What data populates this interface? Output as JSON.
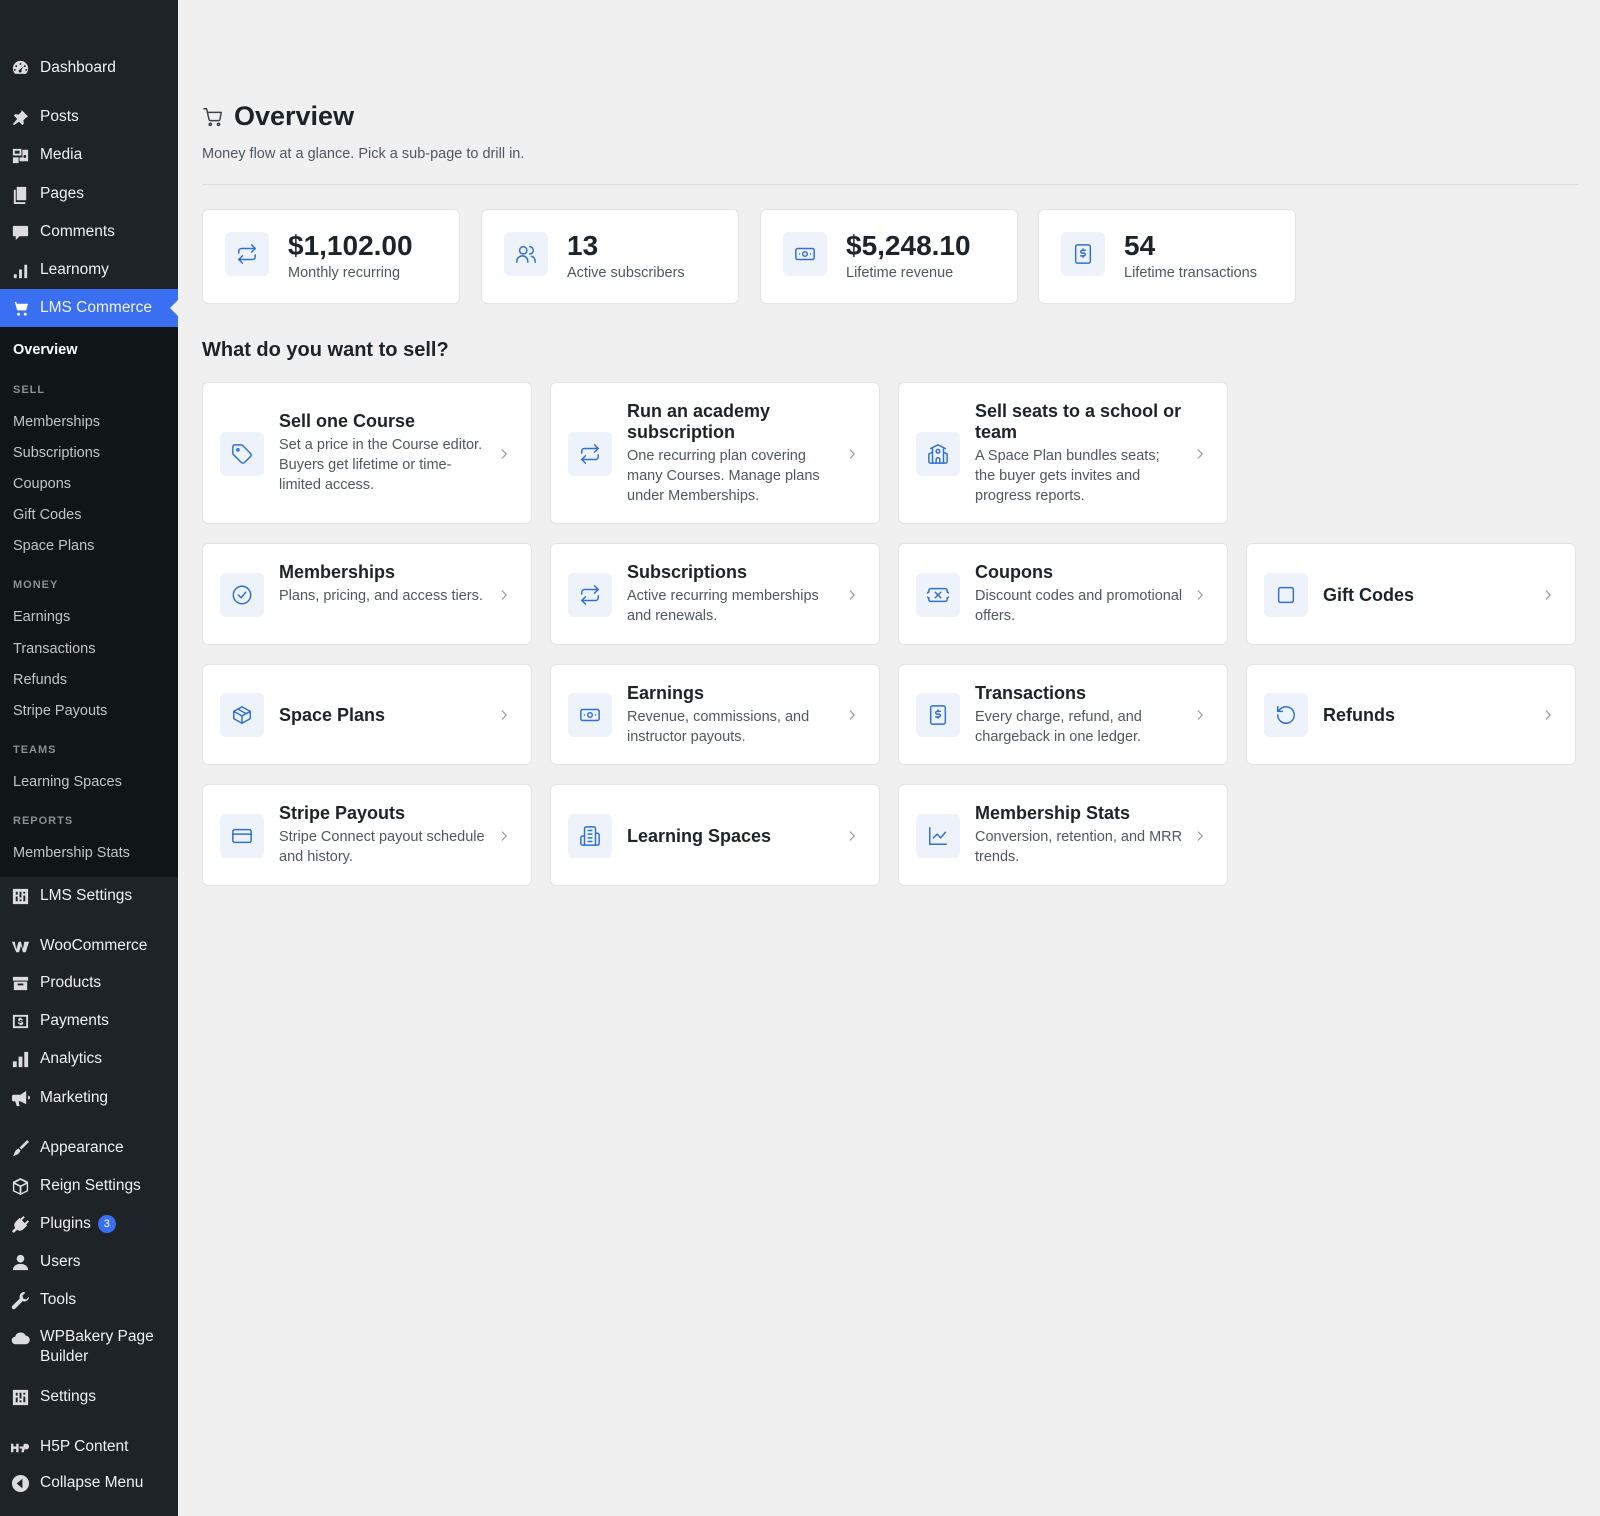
{
  "sidebar": {
    "items": [
      {
        "label": "Dashboard",
        "icon": "dashboard-icon"
      },
      {
        "label": "Posts",
        "icon": "pin-icon"
      },
      {
        "label": "Media",
        "icon": "media-icon"
      },
      {
        "label": "Pages",
        "icon": "pages-icon"
      },
      {
        "label": "Comments",
        "icon": "comment-icon"
      },
      {
        "label": "Learnomy",
        "icon": "bar-chart-icon"
      },
      {
        "label": "LMS Commerce",
        "icon": "cart-icon"
      },
      {
        "label": "LMS Settings",
        "icon": "settings-grid-icon"
      },
      {
        "label": "WooCommerce",
        "icon": "woo-icon"
      },
      {
        "label": "Products",
        "icon": "archive-icon"
      },
      {
        "label": "Payments",
        "icon": "dollar-icon"
      },
      {
        "label": "Analytics",
        "icon": "bar-chart-icon"
      },
      {
        "label": "Marketing",
        "icon": "megaphone-icon"
      },
      {
        "label": "Appearance",
        "icon": "brush-icon"
      },
      {
        "label": "Reign Settings",
        "icon": "cube-icon"
      },
      {
        "label": "Plugins",
        "icon": "plug-icon",
        "badge": "3"
      },
      {
        "label": "Users",
        "icon": "user-icon"
      },
      {
        "label": "Tools",
        "icon": "wrench-icon"
      },
      {
        "label": "WPBakery Page Builder",
        "label_line1": "WPBakery Page",
        "label_line2": "Builder",
        "icon": "cloud-icon"
      },
      {
        "label": "Settings",
        "icon": "settings-grid-icon"
      },
      {
        "label": "H5P Content",
        "icon": "h5p-icon"
      },
      {
        "label": "Collapse Menu",
        "icon": "collapse-icon"
      }
    ],
    "submenu": {
      "overview": "Overview",
      "sell_heading": "SELL",
      "sell": [
        "Memberships",
        "Subscriptions",
        "Coupons",
        "Gift Codes",
        "Space Plans"
      ],
      "money_heading": "MONEY",
      "money": [
        "Earnings",
        "Transactions",
        "Refunds",
        "Stripe Payouts"
      ],
      "teams_heading": "TEAMS",
      "teams": [
        "Learning Spaces"
      ],
      "reports_heading": "REPORTS",
      "reports": [
        "Membership Stats"
      ]
    }
  },
  "header": {
    "title": "Overview",
    "subtitle": "Money flow at a glance. Pick a sub-page to drill in."
  },
  "stats": [
    {
      "value": "$1,102.00",
      "label": "Monthly recurring",
      "icon": "repeat-icon"
    },
    {
      "value": "13",
      "label": "Active subscribers",
      "icon": "users-icon"
    },
    {
      "value": "$5,248.10",
      "label": "Lifetime revenue",
      "icon": "banknote-icon"
    },
    {
      "value": "54",
      "label": "Lifetime transactions",
      "icon": "receipt-icon"
    }
  ],
  "section_title": "What do you want to sell?",
  "cards": {
    "sell_course": {
      "title": "Sell one Course",
      "desc": "Set a price in the Course editor. Buyers get lifetime or time-limited access.",
      "icon": "tag-icon"
    },
    "academy": {
      "title": "Run an academy subscription",
      "desc": "One recurring plan covering many Courses. Manage plans under Memberships.",
      "icon": "repeat-icon"
    },
    "seats": {
      "title": "Sell seats to a school or team",
      "desc": "A Space Plan bundles seats; the buyer gets invites and progress reports.",
      "icon": "school-icon"
    },
    "memberships": {
      "title": "Memberships",
      "desc": "Plans, pricing, and access tiers.",
      "icon": "check-circle-icon"
    },
    "subscriptions": {
      "title": "Subscriptions",
      "desc": "Active recurring memberships and renewals.",
      "icon": "repeat-icon"
    },
    "coupons": {
      "title": "Coupons",
      "desc": "Discount codes and promotional offers.",
      "icon": "ticket-icon"
    },
    "gift_codes": {
      "title": "Gift Codes",
      "icon": "square-icon"
    },
    "space_plans": {
      "title": "Space Plans",
      "icon": "box-icon"
    },
    "earnings": {
      "title": "Earnings",
      "desc": "Revenue, commissions, and instructor payouts.",
      "icon": "banknote-icon"
    },
    "transactions": {
      "title": "Transactions",
      "desc": "Every charge, refund, and chargeback in one ledger.",
      "icon": "receipt-icon"
    },
    "refunds": {
      "title": "Refunds",
      "icon": "undo-icon"
    },
    "stripe_payouts": {
      "title": "Stripe Payouts",
      "desc": "Stripe Connect payout schedule and history.",
      "icon": "credit-card-icon"
    },
    "learning_spaces": {
      "title": "Learning Spaces",
      "icon": "building-icon"
    },
    "membership_stats": {
      "title": "Membership Stats",
      "desc": "Conversion, retention, and MRR trends.",
      "icon": "line-chart-icon"
    }
  },
  "colors": {
    "sidebar_bg": "#1d2327",
    "submenu_bg": "#101517",
    "accent": "#3b6ff2",
    "icon_blue": "#2f6fd6",
    "page_bg": "#f0f0f1"
  }
}
